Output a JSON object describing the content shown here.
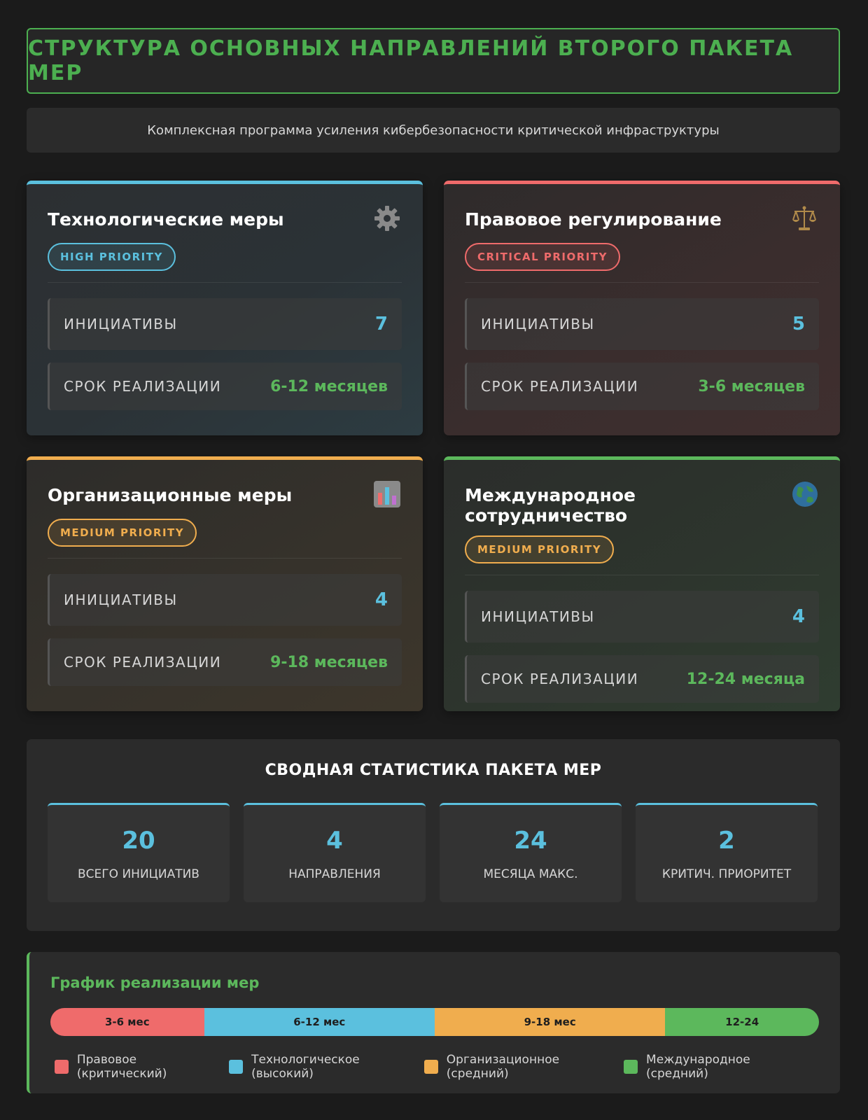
{
  "header": {
    "title": "СТРУКТУРА ОСНОВНЫХ НАПРАВЛЕНИЙ ВТОРОГО ПАКЕТА МЕР",
    "subtitle": "Комплексная программа усиления кибербезопасности критической инфраструктуры"
  },
  "cards": [
    {
      "title": "Технологические меры",
      "icon": "gear-icon",
      "priority": "HIGH PRIORITY",
      "accent": "#5bc0de",
      "initiatives_label": "ИНИЦИАТИВЫ",
      "initiatives": "7",
      "term_label": "СРОК РЕАЛИЗАЦИИ",
      "term": "6-12 месяцев"
    },
    {
      "title": "Правовое регулирование",
      "icon": "scales-icon",
      "priority": "CRITICAL PRIORITY",
      "accent": "#ef6b6b",
      "initiatives_label": "ИНИЦИАТИВЫ",
      "initiatives": "5",
      "term_label": "СРОК РЕАЛИЗАЦИИ",
      "term": "3-6 месяцев"
    },
    {
      "title": "Организационные меры",
      "icon": "bar-chart-icon",
      "priority": "MEDIUM PRIORITY",
      "accent": "#f0ad4e",
      "initiatives_label": "ИНИЦИАТИВЫ",
      "initiatives": "4",
      "term_label": "СРОК РЕАЛИЗАЦИИ",
      "term": "9-18 месяцев"
    },
    {
      "title": "Международное сотрудничество",
      "icon": "globe-icon",
      "priority": "MEDIUM PRIORITY",
      "accent": "#5cb85c",
      "initiatives_label": "ИНИЦИАТИВЫ",
      "initiatives": "4",
      "term_label": "СРОК РЕАЛИЗАЦИИ",
      "term": "12-24 месяца"
    }
  ],
  "stats": {
    "title": "СВОДНАЯ СТАТИСТИКА ПАКЕТА МЕР",
    "items": [
      {
        "value": "20",
        "caption": "ВСЕГО ИНИЦИАТИВ"
      },
      {
        "value": "4",
        "caption": "НАПРАВЛЕНИЯ"
      },
      {
        "value": "24",
        "caption": "МЕСЯЦА МАКС."
      },
      {
        "value": "2",
        "caption": "КРИТИЧ. ПРИОРИТЕТ"
      }
    ]
  },
  "timeline": {
    "title": "График реализации мер",
    "segments": [
      {
        "label": "3-6 мес",
        "color": "#ef6b6b",
        "share": 0.2
      },
      {
        "label": "6-12 мес",
        "color": "#5bc0de",
        "share": 0.3
      },
      {
        "label": "9-18 мес",
        "color": "#f0ad4e",
        "share": 0.3
      },
      {
        "label": "12-24",
        "color": "#5cb85c",
        "share": 0.2
      }
    ],
    "legend": [
      {
        "label": "Правовое (критический)",
        "color": "#ef6b6b"
      },
      {
        "label": "Технологическое (высокий)",
        "color": "#5bc0de"
      },
      {
        "label": "Организационное (средний)",
        "color": "#f0ad4e"
      },
      {
        "label": "Международное (средний)",
        "color": "#5cb85c"
      }
    ]
  }
}
